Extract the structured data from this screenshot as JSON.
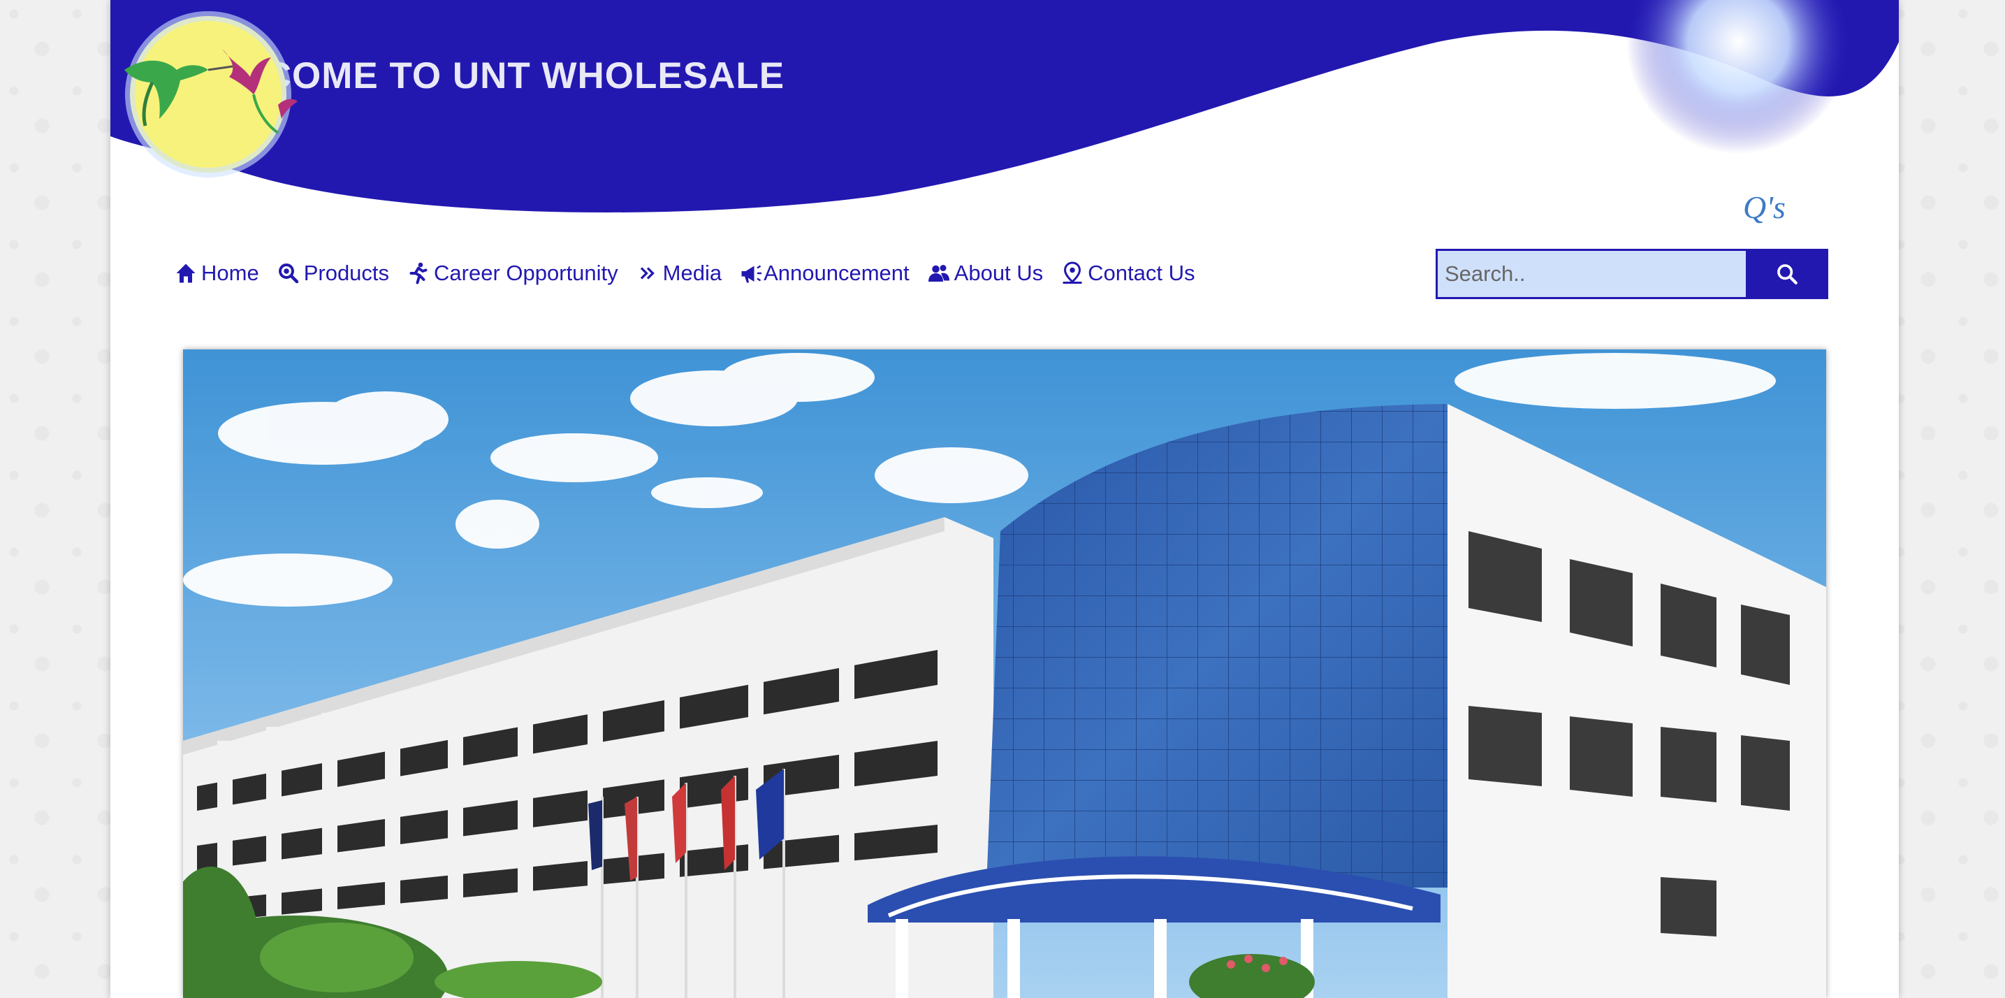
{
  "header": {
    "title": "WELCOME TO UNT WHOLESALE",
    "logo_text": "Q's",
    "brand_color": "#2218b0"
  },
  "nav": {
    "items": [
      {
        "label": "Home",
        "icon": "home-icon"
      },
      {
        "label": "Products",
        "icon": "magnifier-icon"
      },
      {
        "label": "Career Opportunity",
        "icon": "runner-icon"
      },
      {
        "label": "Media",
        "icon": "double-chevron-icon"
      },
      {
        "label": "Announcement",
        "icon": "megaphone-icon"
      },
      {
        "label": "About Us",
        "icon": "users-icon"
      },
      {
        "label": "Contact Us",
        "icon": "location-pin-icon"
      }
    ]
  },
  "search": {
    "placeholder": "Search..",
    "value": "",
    "button_icon": "search-icon"
  },
  "hero": {
    "image": "warehouse-building-photo"
  }
}
